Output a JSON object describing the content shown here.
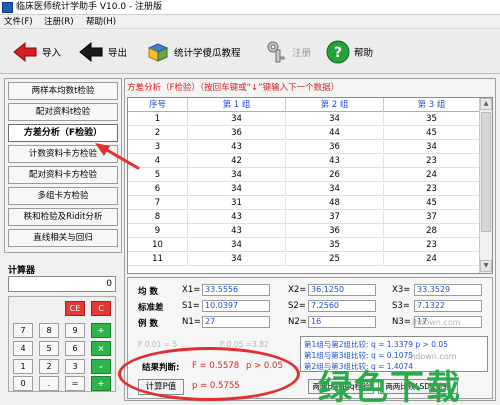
{
  "window": {
    "title": "临床医师统计学助手 V10.0 - 注册版"
  },
  "menu": [
    "文件(F)",
    "注册(R)",
    "帮助(H)"
  ],
  "toolbar": {
    "import_label": "导入",
    "export_label": "导出",
    "tutorial_label": "统计学傻瓜教程",
    "register_label": "注册",
    "help_label": "帮助"
  },
  "nav": {
    "items": [
      "两样本均数t检验",
      "配对资料t检验",
      "方差分析（F检验）",
      "计数资料卡方检验",
      "配对资料卡方检验",
      "多组卡方检验",
      "秩和检验及Ridit分析",
      "直线相关与回归"
    ],
    "active_index": 2
  },
  "calculator": {
    "title": "计算器",
    "display": "0",
    "keys": [
      "CE",
      "C",
      "7",
      "8",
      "9",
      "÷",
      "4",
      "5",
      "6",
      "×",
      "1",
      "2",
      "3",
      "-",
      "0",
      ".",
      "=",
      "+"
    ]
  },
  "main": {
    "header": "方差分析（F检验）（按回车键或“↓”键输入下一个数据）"
  },
  "table": {
    "headers": [
      "序号",
      "第 1 组",
      "第 2 组",
      "第 3 组"
    ],
    "rows": [
      [
        "1",
        "34",
        "34",
        "35"
      ],
      [
        "2",
        "36",
        "44",
        "45"
      ],
      [
        "3",
        "43",
        "36",
        "34"
      ],
      [
        "4",
        "42",
        "43",
        "23"
      ],
      [
        "5",
        "34",
        "26",
        "24"
      ],
      [
        "6",
        "34",
        "34",
        "23"
      ],
      [
        "7",
        "31",
        "48",
        "45"
      ],
      [
        "8",
        "43",
        "37",
        "37"
      ],
      [
        "9",
        "43",
        "36",
        "28"
      ],
      [
        "10",
        "34",
        "35",
        "23"
      ],
      [
        "11",
        "34",
        "25",
        "24"
      ]
    ]
  },
  "stats": {
    "mean_label": "均  数",
    "sd_label": "标准差",
    "n_label": "例  数",
    "x1_label": "X1=",
    "x1": "33.5556",
    "x2_label": "X2=",
    "x2": "36.1250",
    "x3_label": "X3=",
    "x3": "33.3529",
    "s1_label": "S1=",
    "s1": "10.0397",
    "s2_label": "S2=",
    "s2": "7.2560",
    "s3_label": "S3=",
    "s3": "7.1322",
    "n1_label": "N1=",
    "n1": "27",
    "n2_label": "N2=",
    "n2": "16",
    "n3_label": "N3=",
    "n3": "17"
  },
  "faded": {
    "f_left": "F 0.01  = 5",
    "f_right": "F 0.05 =3.82"
  },
  "comparisons": [
    "第1组与第2组比较: q = 1.3379  p > 0.05",
    "第1组与第3组比较: q = 0.1075",
    "第2组与第3组比较: q = 1.4074"
  ],
  "result": {
    "label": "结果判断:",
    "f": "F = 0.5578",
    "p_cmp": "p > 0.05",
    "p": "p = 0.5755",
    "calc_button": "计算P值"
  },
  "buttons": {
    "q_test": "两两比较的q检验",
    "lsd_test": "两两比较LSD-t检验"
  },
  "watermark": {
    "site": "lhdown.com",
    "big": "绿色下载"
  }
}
